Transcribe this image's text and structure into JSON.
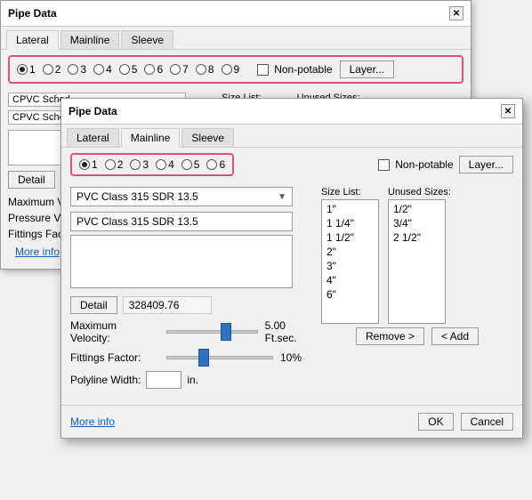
{
  "bg_window": {
    "title": "Pipe Data",
    "close_label": "✕",
    "tabs": [
      "Lateral",
      "Mainline",
      "Sleeve"
    ],
    "active_tab": "Lateral",
    "radio_items": [
      "1",
      "2",
      "3",
      "4",
      "5",
      "6",
      "7",
      "8",
      "9"
    ],
    "selected_radio": "1",
    "nonpotable_label": "Non-potable",
    "layer_button": "Layer...",
    "size_list_label": "Size List:",
    "unused_sizes_label": "Unused Sizes:",
    "schedule_label_1": "CPVC Sched",
    "schedule_label_2": "CPVC Sched",
    "detail_button": "Detail",
    "max_velocity_label": "Maximum Veloci",
    "pressure_label": "Pressure Varia",
    "fittings_label": "Fittings Factor",
    "more_info": "More info"
  },
  "fg_window": {
    "title": "Pipe Data",
    "close_label": "✕",
    "tabs": [
      "Lateral",
      "Mainline",
      "Sleeve"
    ],
    "active_tab": "Mainline",
    "radio_items": [
      "1",
      "2",
      "3",
      "4",
      "5",
      "6"
    ],
    "selected_radio": "1",
    "nonpotable_label": "Non-potable",
    "layer_button": "Layer...",
    "dropdown_value": "PVC Class 315 SDR 13.5",
    "text_input_value": "PVC Class 315 SDR 13.5",
    "detail_button": "Detail",
    "detail_value": "328409.76",
    "max_velocity_label": "Maximum Velocity:",
    "max_velocity_value": "5.00 Ft.sec.",
    "fittings_label": "Fittings Factor:",
    "fittings_value": "10%",
    "polyline_label": "Polyline Width:",
    "polyline_unit": "in.",
    "size_list_label": "Size List:",
    "unused_sizes_label": "Unused Sizes:",
    "size_list_items": [
      "1\"",
      "1 1/4\"",
      "1 1/2\"",
      "2\"",
      "3\"",
      "4\"",
      "6\""
    ],
    "unused_sizes_items": [
      "1/2\"",
      "3/4\"",
      "2 1/2\""
    ],
    "remove_button": "Remove >",
    "add_button": "< Add",
    "more_info": "More info",
    "ok_button": "OK",
    "cancel_button": "Cancel"
  }
}
